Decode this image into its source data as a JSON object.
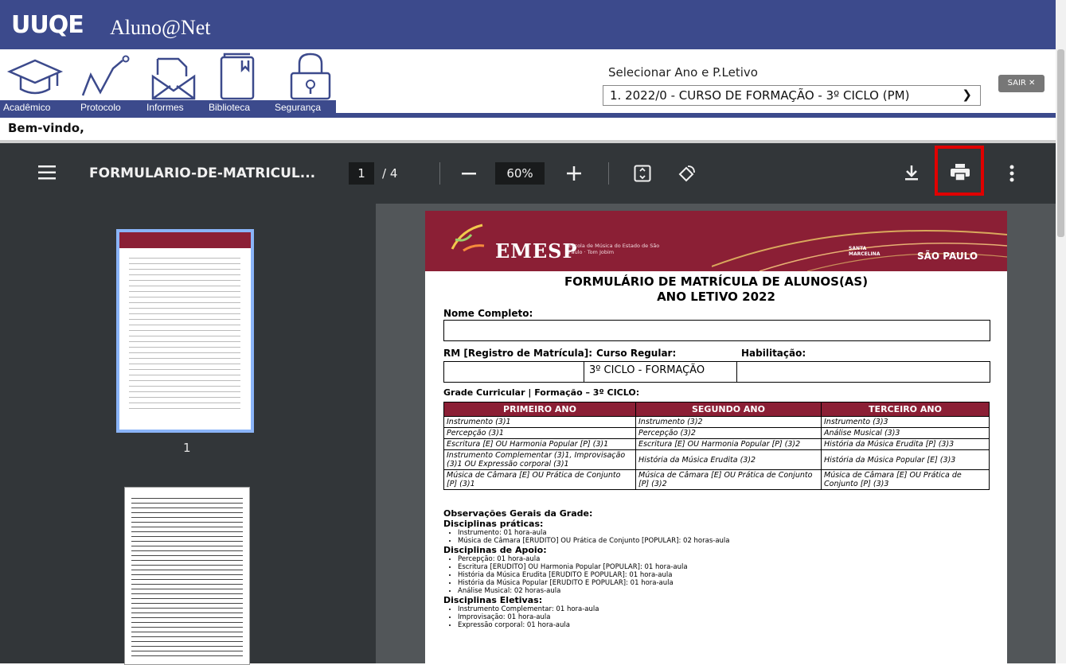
{
  "app": {
    "logo": "UUQE",
    "title": "Aluno@Net"
  },
  "nav": [
    {
      "label": "Acadêmico",
      "icon": "graduation-cap-icon"
    },
    {
      "label": "Protocolo",
      "icon": "graph-line-icon"
    },
    {
      "label": "Informes",
      "icon": "envelope-icon"
    },
    {
      "label": "Biblioteca",
      "icon": "book-icon"
    },
    {
      "label": "Segurança",
      "icon": "lock-icon"
    }
  ],
  "period": {
    "label": "Selecionar Ano e P.Letivo",
    "selected": "1. 2022/0 - CURSO DE FORMAÇÃO - 3º CICLO (PM)"
  },
  "logout": "SAIR ✕",
  "welcome": "Bem-vindo,",
  "viewer": {
    "filename": "FORMULARIO-DE-MATRICUL...",
    "page_current": "1",
    "page_sep": "/ 4",
    "zoom": "60%",
    "thumb_label": "1"
  },
  "doc": {
    "brand": "EMESP",
    "brand_sub": "Escola de Música do Estado de São Paulo · Tom Jobim",
    "partner1": "SANTA MARCELINA",
    "partner2": "SÃO PAULO",
    "title1": "FORMULÁRIO DE MATRÍCULA DE ALUNOS(AS)",
    "title2": "ANO LETIVO 2022",
    "nome_label": "Nome Completo:",
    "rm_label": "RM [Registro de Matrícula]:",
    "curso_label": "Curso Regular:",
    "hab_label": "Habilitação:",
    "curso_value": "3º CICLO - FORMAÇÃO",
    "grade_label": "Grade Curricular | Formação – 3º CICLO:",
    "grade_headers": [
      "PRIMEIRO ANO",
      "SEGUNDO ANO",
      "TERCEIRO ANO"
    ],
    "grade_rows": [
      [
        "Instrumento (3)1",
        "Instrumento (3)2",
        "Instrumento (3)3"
      ],
      [
        "Percepção (3)1",
        "Percepção (3)2",
        "Análise Musical (3)3"
      ],
      [
        "Escritura [E] OU Harmonia Popular [P] (3)1",
        "Escritura [E] OU Harmonia Popular [P] (3)2",
        "História da Música Erudita [P] (3)3"
      ],
      [
        "Instrumento Complementar (3)1, Improvisação (3)1 OU Expressão corporal (3)1",
        "História da Música Erudita (3)2",
        "História da Música Popular [E] (3)3"
      ],
      [
        "Música de Câmara [E] OU Prática de Conjunto [P] (3)1",
        "Música de Câmara [E] OU Prática de Conjunto [P] (3)2",
        "Música de Câmara [E] OU Prática de Conjunto [P] (3)3"
      ]
    ],
    "obs_title": "Observações Gerais da Grade:",
    "praticas_title": "Disciplinas práticas:",
    "praticas": [
      "Instrumento: 01 hora-aula",
      "Música de Câmara [ERUDITO] OU Prática de Conjunto [POPULAR]: 02 horas-aula"
    ],
    "apoio_title": "Disciplinas de Apoio:",
    "apoio": [
      "Percepção: 01 hora-aula",
      "Escritura [ERUDITO] OU Harmonia Popular [POPULAR]: 01 hora-aula",
      "História da Música Erudita [ERUDITO E POPULAR]: 01 hora-aula",
      "História da Música Popular [ERUDITO E POPULAR]: 01 hora-aula",
      "Análise Musical: 02 horas-aula"
    ],
    "eletivas_title": "Disciplinas Eletivas:",
    "eletivas": [
      "Instrumento Complementar: 01 hora-aula",
      "Improvisação: 01 hora-aula",
      "Expressão corporal: 01 hora-aula"
    ]
  },
  "colors": {
    "brand": "#3c4a8c",
    "pdf_toolbar": "#323639",
    "doc_accent": "#8b1f35",
    "highlight": "#e00000"
  }
}
